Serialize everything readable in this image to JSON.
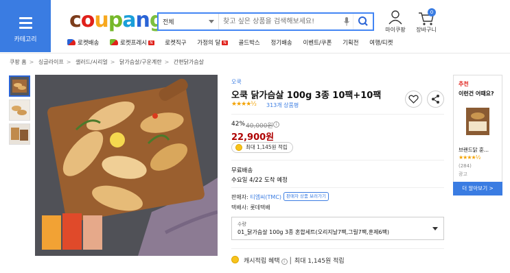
{
  "header": {
    "category_label": "카테고리",
    "logo_letters": [
      "c",
      "o",
      "u",
      "p",
      "a",
      "n",
      "g"
    ],
    "search": {
      "category": "전체",
      "placeholder": "찾고 싶은 상품을 검색해보세요!"
    },
    "mypage_label": "마이쿠팡",
    "cart_label": "장바구니",
    "cart_count": "0"
  },
  "nav": [
    {
      "label": "로켓배송",
      "icon": "rocket-blue-icon"
    },
    {
      "label": "로켓프레시",
      "icon": "rocket-green-icon",
      "badge": "N"
    },
    {
      "label": "로켓직구"
    },
    {
      "label": "가정의 달",
      "badge": "N"
    },
    {
      "label": "골드박스"
    },
    {
      "label": "정기배송"
    },
    {
      "label": "이벤트/쿠폰"
    },
    {
      "label": "기획전"
    },
    {
      "label": "여행/티켓"
    }
  ],
  "breadcrumb": [
    "쿠팡 홈",
    "싱글라이프",
    "샐러드/시리얼",
    "닭가슴살/구운계란",
    "간편닭가슴살"
  ],
  "product": {
    "brand": "오쿡",
    "title": "오쿡 닭가슴살 100g 3종 10팩+10팩",
    "stars": "★★★★½",
    "rating": 4.5,
    "review_count": "313개 상품평",
    "discount": "42%",
    "original_price": "40,000원",
    "price": "22,900원",
    "cash_pill": "최대 1,145원 적립",
    "shipping_title": "무료배송",
    "shipping_date": "수요일 4/22 도착 예정",
    "seller_prefix": "판매자: ",
    "seller_name": "티엠씨(TMC)",
    "seller_button": "판매자 상품 보러가기",
    "delivery_company": "택배사: 롯데택배",
    "option_label": "수량",
    "option_value": "01_닭가슴살 100g 3종 혼합세트(오리지날7팩,그릴7팩,훈제6팩)",
    "cash_label": "캐시적립 혜택",
    "cash_value": "최대 1,145원 적립"
  },
  "recommend": {
    "title1": "추천",
    "title2": "이런건 어때요?",
    "item_name": "브랜드닭 훈...",
    "stars": "★★★★½",
    "count": "(284)",
    "ad_label": "광고",
    "more_button": "더 알아보기 >"
  }
}
